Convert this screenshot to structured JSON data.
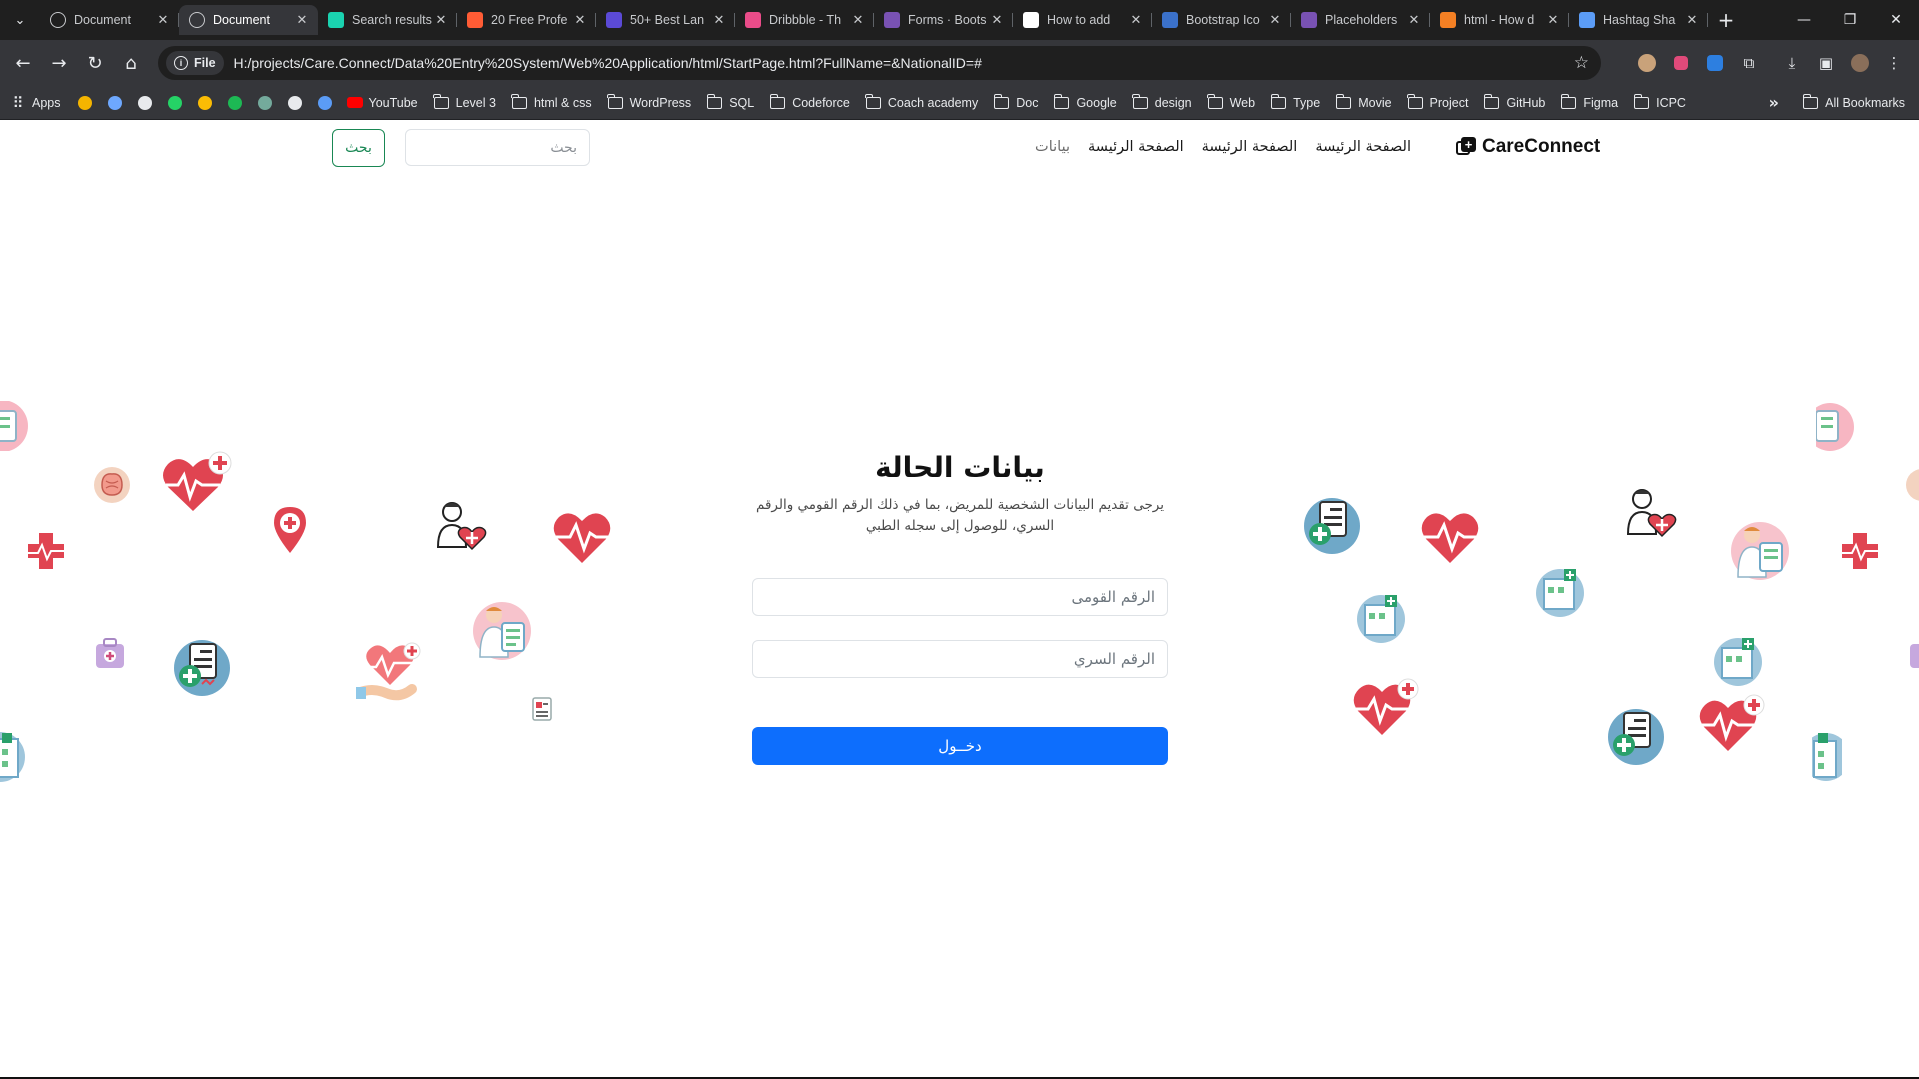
{
  "browser": {
    "tabs": [
      {
        "title": "Document",
        "favicon": "globe-icon",
        "color": "#5f6368",
        "active": false
      },
      {
        "title": "Document",
        "favicon": "globe-icon",
        "color": "#5f6368",
        "active": true
      },
      {
        "title": "Search results",
        "favicon": "vuetify-icon",
        "color": "#1ad3b0",
        "active": false
      },
      {
        "title": "20 Free Profe",
        "favicon": "hubspot-icon",
        "color": "#ff5c35",
        "active": false
      },
      {
        "title": "50+ Best Lan",
        "favicon": "site-icon",
        "color": "#5b4ad6",
        "active": false
      },
      {
        "title": "Dribbble - Th",
        "favicon": "dribbble-icon",
        "color": "#ea4c89",
        "active": false
      },
      {
        "title": "Forms · Boots",
        "favicon": "bootstrap-icon",
        "color": "#7952b3",
        "active": false
      },
      {
        "title": "How to add",
        "favicon": "openai-icon",
        "color": "#ffffff",
        "active": false
      },
      {
        "title": "Bootstrap Ico",
        "favicon": "mdb-icon",
        "color": "#3b71ca",
        "active": false
      },
      {
        "title": "Placeholders",
        "favicon": "bootstrap-icon",
        "color": "#7952b3",
        "active": false
      },
      {
        "title": "html - How d",
        "favicon": "stackoverflow-icon",
        "color": "#f48024",
        "active": false
      },
      {
        "title": "Hashtag Sha",
        "favicon": "flag-icon",
        "color": "#5b9cf6",
        "active": false
      }
    ],
    "file_label": "File",
    "url": "H:/projects/Care.Connect/Data%20Entry%20System/Web%20Application/html/StartPage.html?FullName=&NationalID=#",
    "bookmarks": [
      {
        "label": "Apps",
        "icon": "apps-grid-icon"
      },
      {
        "label": "",
        "icon": "mt-icon"
      },
      {
        "label": "",
        "icon": "gemini-icon"
      },
      {
        "label": "",
        "icon": "bulb-icon"
      },
      {
        "label": "",
        "icon": "whatsapp-icon"
      },
      {
        "label": "",
        "icon": "keep-icon"
      },
      {
        "label": "",
        "icon": "spotify-icon"
      },
      {
        "label": "",
        "icon": "chatgpt-icon"
      },
      {
        "label": "",
        "icon": "notion-icon"
      },
      {
        "label": "",
        "icon": "flag-icon"
      },
      {
        "label": "YouTube",
        "icon": "youtube-icon"
      },
      {
        "label": "Level 3",
        "icon": "folder-icon"
      },
      {
        "label": "html & css",
        "icon": "folder-icon"
      },
      {
        "label": "WordPress",
        "icon": "folder-icon"
      },
      {
        "label": "SQL",
        "icon": "folder-icon"
      },
      {
        "label": "Codeforce",
        "icon": "folder-icon"
      },
      {
        "label": "Coach academy",
        "icon": "folder-icon"
      },
      {
        "label": "Doc",
        "icon": "folder-icon"
      },
      {
        "label": "Google",
        "icon": "folder-icon"
      },
      {
        "label": "design",
        "icon": "folder-icon"
      },
      {
        "label": "Web",
        "icon": "folder-icon"
      },
      {
        "label": "Type",
        "icon": "folder-icon"
      },
      {
        "label": "Movie",
        "icon": "folder-icon"
      },
      {
        "label": "Project",
        "icon": "folder-icon"
      },
      {
        "label": "GitHub",
        "icon": "folder-icon"
      },
      {
        "label": "Figma",
        "icon": "folder-icon"
      },
      {
        "label": "ICPC",
        "icon": "folder-icon"
      }
    ],
    "all_bookmarks": "All Bookmarks"
  },
  "site": {
    "brand": "CareConnect",
    "nav": [
      {
        "label": "الصفحة الرئيسة",
        "muted": false
      },
      {
        "label": "الصفحة الرئيسة",
        "muted": false
      },
      {
        "label": "الصفحة الرئيسة",
        "muted": false
      },
      {
        "label": "بيانات",
        "muted": true
      }
    ],
    "search_placeholder": "بحث",
    "search_button": "بحث"
  },
  "form": {
    "title": "بيانات الحالة",
    "description": "يرجى تقديم البيانات الشخصية للمريض، بما في ذلك الرقم القومي والرقم السري، للوصول إلى سجله الطبي",
    "national_id_placeholder": "الرقم القومى",
    "password_placeholder": "الرقم السري",
    "submit": "دخــول"
  },
  "colors": {
    "primary": "#0d6efd",
    "success": "#198754",
    "heart_red": "#e63946"
  }
}
